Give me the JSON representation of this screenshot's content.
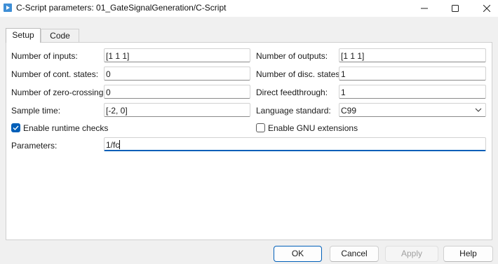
{
  "window": {
    "title": "C-Script parameters: 01_GateSignalGeneration/C-Script",
    "icon": "play-icon",
    "controls": [
      "minimize-icon",
      "maximize-icon",
      "close-icon"
    ]
  },
  "tabs": [
    {
      "label": "Setup",
      "active": true
    },
    {
      "label": "Code",
      "active": false
    }
  ],
  "left_fields": [
    {
      "label": "Number of inputs:",
      "value": "[1 1 1]"
    },
    {
      "label": "Number of cont. states:",
      "value": "0"
    },
    {
      "label": "Number of zero-crossings:",
      "value": "0"
    },
    {
      "label": "Sample time:",
      "value": "[-2, 0]"
    }
  ],
  "right_fields": [
    {
      "label": "Number of outputs:",
      "value": "[1 1 1]"
    },
    {
      "label": "Number of disc. states:",
      "value": "1"
    },
    {
      "label": "Direct feedthrough:",
      "value": "1"
    }
  ],
  "language": {
    "label": "Language standard:",
    "value": "C99"
  },
  "checks": {
    "runtime": {
      "label": "Enable runtime checks",
      "checked": true
    },
    "gnu": {
      "label": "Enable GNU extensions",
      "checked": false
    }
  },
  "parameters": {
    "label": "Parameters:",
    "value": "1/fc"
  },
  "buttons": {
    "ok": "OK",
    "cancel": "Cancel",
    "apply": "Apply",
    "help": "Help"
  },
  "colors": {
    "accent": "#005fb8",
    "icon": "#3f8fd6"
  }
}
